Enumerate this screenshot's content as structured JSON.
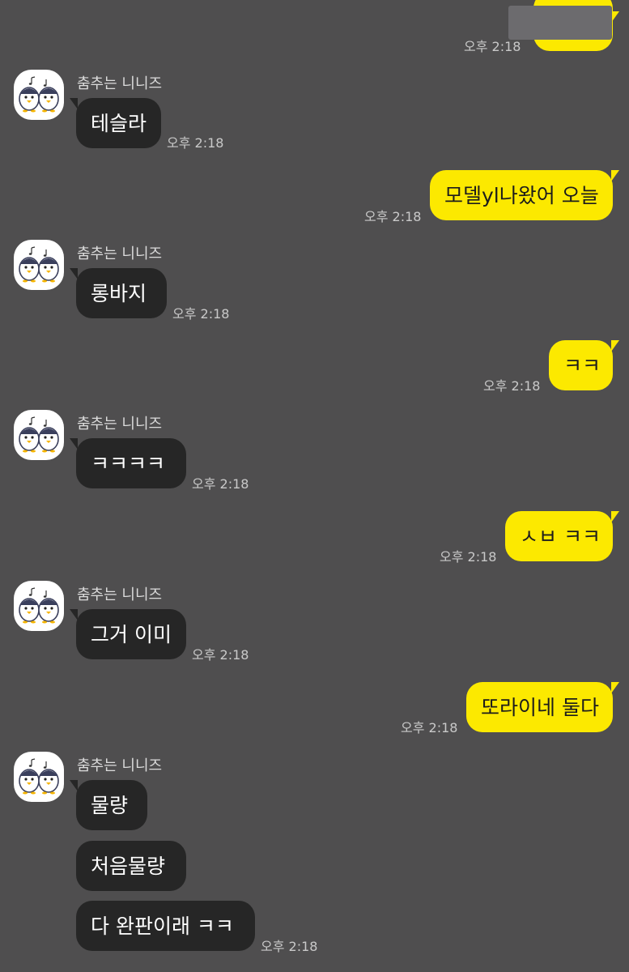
{
  "sender_name": "춤추는 니니즈",
  "avatar_icon": "ducks-avatar-icon",
  "colors": {
    "background": "#4f4e4f",
    "incoming_bubble": "#262626",
    "outgoing_bubble": "#fce900"
  },
  "messages": [
    {
      "dir": "out",
      "text": "",
      "time": "오후 2:18"
    },
    {
      "dir": "in",
      "text": "테슬라",
      "time": "오후 2:18"
    },
    {
      "dir": "out",
      "text": "모델yl나왔어 오늘",
      "time": "오후 2:18"
    },
    {
      "dir": "in",
      "text": "롱바지",
      "time": "오후 2:18"
    },
    {
      "dir": "out",
      "text": "ㅋㅋ",
      "time": "오후 2:18"
    },
    {
      "dir": "in",
      "text": "ㅋㅋㅋㅋ",
      "time": "오후 2:18"
    },
    {
      "dir": "out",
      "text": "ㅅㅂ ㅋㅋ",
      "time": "오후 2:18"
    },
    {
      "dir": "in",
      "text": "그거 이미",
      "time": "오후 2:18"
    },
    {
      "dir": "out",
      "text": "또라이네 둘다",
      "time": "오후 2:18"
    },
    {
      "dir": "in",
      "text": "물량",
      "time": ""
    },
    {
      "dir": "in",
      "text": "처음물량",
      "time": ""
    },
    {
      "dir": "in",
      "text": "다 완판이래 ㅋㅋ",
      "time": "오후 2:18"
    }
  ]
}
